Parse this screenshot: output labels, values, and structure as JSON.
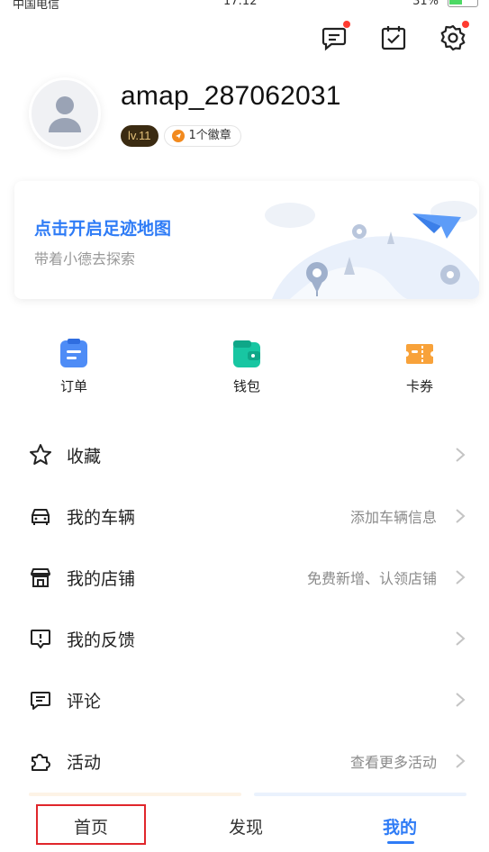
{
  "status": {
    "carrier": "中国电信",
    "time": "17:12",
    "battery": "31%"
  },
  "profile": {
    "username": "amap_287062031",
    "level": "lv.11",
    "medals": "1个徽章"
  },
  "banner": {
    "title": "点击开启足迹地图",
    "subtitle": "带着小德去探索"
  },
  "quick_actions": [
    {
      "label": "订单",
      "icon": "order-icon"
    },
    {
      "label": "钱包",
      "icon": "wallet-icon"
    },
    {
      "label": "卡券",
      "icon": "coupon-icon"
    }
  ],
  "menu": [
    {
      "label": "收藏",
      "detail": "",
      "icon": "star-icon"
    },
    {
      "label": "我的车辆",
      "detail": "添加车辆信息",
      "icon": "car-icon"
    },
    {
      "label": "我的店铺",
      "detail": "免费新增、认领店铺",
      "icon": "store-icon"
    },
    {
      "label": "我的反馈",
      "detail": "",
      "icon": "feedback-icon"
    },
    {
      "label": "评论",
      "detail": "",
      "icon": "comment-icon"
    },
    {
      "label": "活动",
      "detail": "查看更多活动",
      "icon": "activity-icon"
    }
  ],
  "tabs": {
    "home": "首页",
    "discover": "发现",
    "mine": "我的",
    "active": "我的"
  },
  "colors": {
    "accent": "#2f7cf6",
    "badge_dot": "#ff3b30",
    "highlight": "#e0262b"
  }
}
